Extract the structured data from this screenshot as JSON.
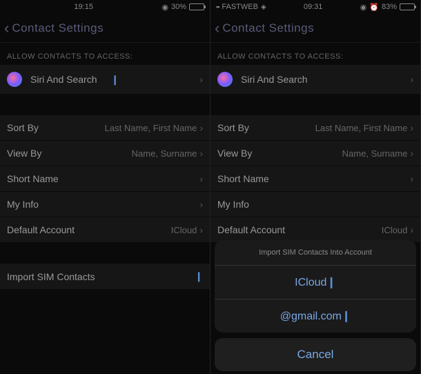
{
  "left": {
    "status": {
      "time": "19:15",
      "location_glyph": "◉",
      "battery_pct": "30%",
      "battery_glyph": ""
    },
    "nav": {
      "back_glyph": "‹",
      "title": "Contact Settings"
    },
    "section_access": "ALLOW CONTACTS TO ACCESS:",
    "siri": {
      "label": "Siri And Search"
    },
    "items": {
      "sort_by": {
        "label": "Sort By",
        "value": "Last Name, First Name"
      },
      "view_by": {
        "label": "View By",
        "value": "Name, Surname"
      },
      "short_name": {
        "label": "Short Name",
        "value": ""
      },
      "my_info": {
        "label": "My Info",
        "value": ""
      },
      "default_account": {
        "label": "Default Account",
        "value": "ICloud"
      }
    },
    "import_sim": {
      "label": "Import SIM Contacts"
    }
  },
  "right": {
    "status": {
      "carrier": "FASTWEB",
      "signal_glyph": "▪▪",
      "wifi_glyph": "◈",
      "time": "09:31",
      "location_glyph": "◉",
      "alarm_glyph": "⏰",
      "battery_pct": "83%",
      "battery_glyph": ""
    },
    "nav": {
      "back_glyph": "‹",
      "title": "Contact Settings"
    },
    "section_access": "ALLOW CONTACTS TO ACCESS:",
    "siri": {
      "label": "Siri And Search"
    },
    "items": {
      "sort_by": {
        "label": "Sort By",
        "value": "Last Name, First Name"
      },
      "view_by": {
        "label": "View By",
        "value": "Name, Surname"
      },
      "short_name": {
        "label": "Short Name",
        "value": ""
      },
      "my_info": {
        "label": "My Info",
        "value": ""
      },
      "default_account": {
        "label": "Default Account",
        "value": "ICloud"
      }
    },
    "action_sheet": {
      "title": "Import SIM Contacts Into Account",
      "option_icloud": "ICloud",
      "option_gmail": "@gmail.com",
      "cancel": "Cancel"
    }
  },
  "chevron": "›"
}
